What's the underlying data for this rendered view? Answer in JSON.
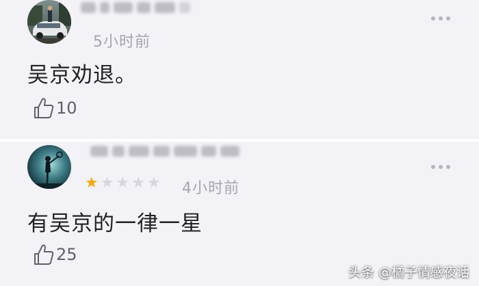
{
  "comments": [
    {
      "time": "5小时前",
      "text": "吴京劝退。",
      "likes": "10",
      "rating": null,
      "avatar_icon": "user-photo-car-avatar"
    },
    {
      "time": "4小时前",
      "text": "有吴京的一律一星",
      "likes": "25",
      "rating": 1,
      "rating_max": 5,
      "avatar_icon": "user-photo-silhouette-avatar"
    }
  ],
  "watermark": "头条 @橘子情感夜话",
  "colors": {
    "background": "#f3f2f7",
    "star_active": "#f2a90f",
    "star_inactive": "#d6d6dc",
    "meta_text": "#a4a6ac"
  }
}
